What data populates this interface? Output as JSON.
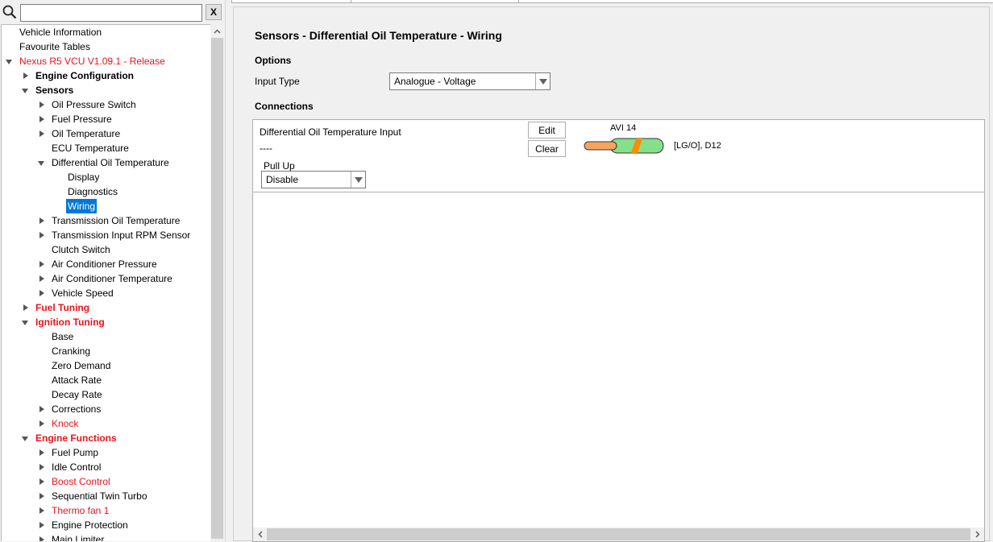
{
  "search": {
    "placeholder": "",
    "value": "",
    "clear_label": "X"
  },
  "tree": [
    {
      "label": "Vehicle Information",
      "level": 0,
      "expander": "none",
      "style": "normal"
    },
    {
      "label": "Favourite Tables",
      "level": 0,
      "expander": "none",
      "style": "normal"
    },
    {
      "label": "Nexus R5 VCU V1.09.1 - Release",
      "level": 0,
      "expander": "expanded",
      "style": "red"
    },
    {
      "label": "Engine Configuration",
      "level": 1,
      "expander": "collapsed",
      "style": "bold"
    },
    {
      "label": "Sensors",
      "level": 1,
      "expander": "expanded",
      "style": "bold"
    },
    {
      "label": "Oil Pressure Switch",
      "level": 2,
      "expander": "collapsed",
      "style": "normal"
    },
    {
      "label": "Fuel Pressure",
      "level": 2,
      "expander": "collapsed",
      "style": "normal"
    },
    {
      "label": "Oil Temperature",
      "level": 2,
      "expander": "collapsed",
      "style": "normal"
    },
    {
      "label": "ECU Temperature",
      "level": 2,
      "expander": "none",
      "style": "normal"
    },
    {
      "label": "Differential Oil Temperature",
      "level": 2,
      "expander": "expanded",
      "style": "normal"
    },
    {
      "label": "Display",
      "level": 3,
      "expander": "none",
      "style": "normal"
    },
    {
      "label": "Diagnostics",
      "level": 3,
      "expander": "none",
      "style": "normal"
    },
    {
      "label": "Wiring",
      "level": 3,
      "expander": "none",
      "style": "selected"
    },
    {
      "label": "Transmission Oil Temperature",
      "level": 2,
      "expander": "collapsed",
      "style": "normal"
    },
    {
      "label": "Transmission Input RPM Sensor",
      "level": 2,
      "expander": "collapsed",
      "style": "normal"
    },
    {
      "label": "Clutch Switch",
      "level": 2,
      "expander": "none",
      "style": "normal"
    },
    {
      "label": "Air Conditioner Pressure",
      "level": 2,
      "expander": "collapsed",
      "style": "normal"
    },
    {
      "label": "Air Conditioner Temperature",
      "level": 2,
      "expander": "collapsed",
      "style": "normal"
    },
    {
      "label": "Vehicle Speed",
      "level": 2,
      "expander": "collapsed",
      "style": "normal"
    },
    {
      "label": "Fuel Tuning",
      "level": 1,
      "expander": "collapsed",
      "style": "red-bold"
    },
    {
      "label": "Ignition Tuning",
      "level": 1,
      "expander": "expanded",
      "style": "red-bold"
    },
    {
      "label": "Base",
      "level": 2,
      "expander": "none",
      "style": "normal"
    },
    {
      "label": "Cranking",
      "level": 2,
      "expander": "none",
      "style": "normal"
    },
    {
      "label": "Zero Demand",
      "level": 2,
      "expander": "none",
      "style": "normal"
    },
    {
      "label": "Attack Rate",
      "level": 2,
      "expander": "none",
      "style": "normal"
    },
    {
      "label": "Decay Rate",
      "level": 2,
      "expander": "none",
      "style": "normal"
    },
    {
      "label": "Corrections",
      "level": 2,
      "expander": "collapsed",
      "style": "normal"
    },
    {
      "label": "Knock",
      "level": 2,
      "expander": "collapsed",
      "style": "red"
    },
    {
      "label": "Engine Functions",
      "level": 1,
      "expander": "expanded",
      "style": "red-bold"
    },
    {
      "label": "Fuel Pump",
      "level": 2,
      "expander": "collapsed",
      "style": "normal"
    },
    {
      "label": "Idle Control",
      "level": 2,
      "expander": "collapsed",
      "style": "normal"
    },
    {
      "label": "Boost Control",
      "level": 2,
      "expander": "collapsed",
      "style": "red"
    },
    {
      "label": "Sequential Twin Turbo",
      "level": 2,
      "expander": "collapsed",
      "style": "normal"
    },
    {
      "label": "Thermo fan 1",
      "level": 2,
      "expander": "collapsed",
      "style": "red"
    },
    {
      "label": "Engine Protection",
      "level": 2,
      "expander": "collapsed",
      "style": "normal"
    },
    {
      "label": "Main Limiter",
      "level": 2,
      "expander": "collapsed",
      "style": "normal"
    }
  ],
  "page": {
    "title": "Sensors - Differential Oil Temperature - Wiring",
    "options_heading": "Options",
    "input_type_label": "Input Type",
    "input_type_value": "Analogue - Voltage",
    "connections_heading": "Connections"
  },
  "connection": {
    "name": "Differential Oil Temperature Input",
    "value": "----",
    "pullup_label": "Pull Up",
    "pullup_value": "Disable",
    "edit_label": "Edit",
    "clear_label": "Clear",
    "pin": "AVI 14",
    "wire_code": "[LG/O], D12",
    "wire_colors": {
      "insulation": "#86e08a",
      "stripe": "#ff8c00",
      "conductor": "#f4a460"
    }
  },
  "colors": {
    "accent": "#0078d7",
    "warning_text": "#e8141b"
  }
}
